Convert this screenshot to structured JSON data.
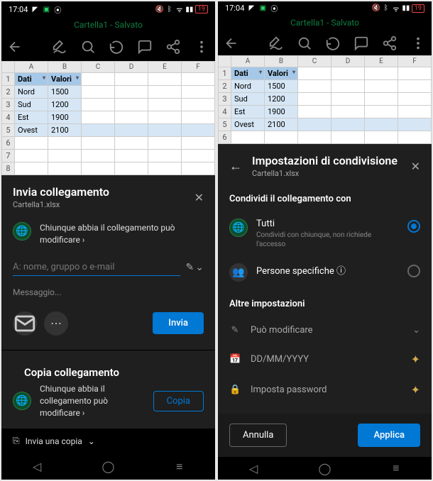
{
  "status": {
    "time": "17:04",
    "battery": "19"
  },
  "doc_title": "Cartella1 - Salvato",
  "sheet": {
    "headers": [
      "Dati",
      "Valori"
    ],
    "rows": [
      {
        "a": "Nord",
        "b": "1500"
      },
      {
        "a": "Sud",
        "b": "1200"
      },
      {
        "a": "Est",
        "b": "1900"
      },
      {
        "a": "Ovest",
        "b": "2100"
      }
    ]
  },
  "left": {
    "panel_title": "Invia collegamento",
    "filename": "Cartella1.xlsx",
    "link_desc": "Chiunque abbia il collegamento può modificare ›",
    "to_placeholder": "A: nome, gruppo o e-mail",
    "message_placeholder": "Messaggio...",
    "send_label": "Invia",
    "copy_title": "Copia collegamento",
    "copy_desc": "Chiunque abbia il collegamento può modificare ›",
    "copy_btn": "Copia",
    "send_copy": "Invia una copia"
  },
  "right": {
    "panel_title": "Impostazioni di condivisione",
    "filename": "Cartella1.xlsx",
    "share_with_label": "Condividi il collegamento con",
    "opt_all_title": "Tutti",
    "opt_all_sub": "Condividi con chiunque, non richiede l'accesso",
    "opt_specific": "Persone specifiche ⓘ",
    "other_settings": "Altre impostazioni",
    "can_edit": "Può modificare",
    "date_placeholder": "DD/MM/YYYY",
    "password_placeholder": "Imposta password",
    "cancel": "Annulla",
    "apply": "Applica"
  }
}
